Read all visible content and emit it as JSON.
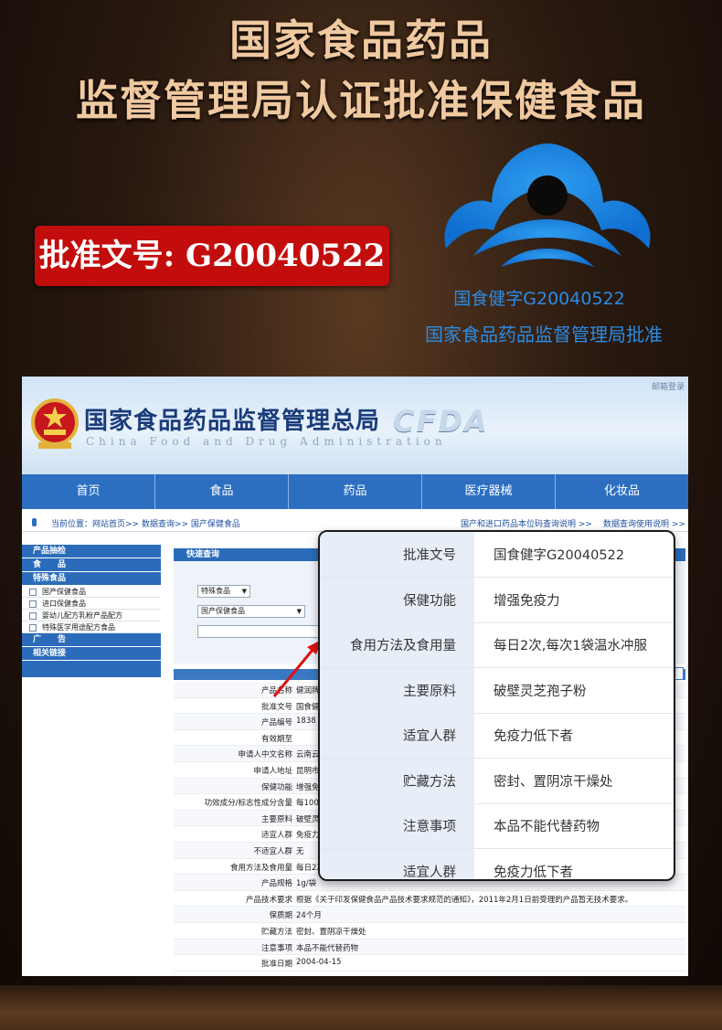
{
  "headline": {
    "line1": "国家食品药品",
    "line2": "监督管理局认证批准保健食品"
  },
  "badge": {
    "text": "批准文号: G20040522"
  },
  "logo": {
    "caption1": "国食健字G20040522",
    "caption2": "国家食品药品监督管理局批准"
  },
  "site": {
    "title": "国家食品药品监督管理总局",
    "subtitle": "China Food and Drug Administration",
    "brand": "CFDA",
    "login": "邮箱登录",
    "nav": [
      "首页",
      "食品",
      "药品",
      "医疗器械",
      "化妆品"
    ],
    "breadcrumb": "当前位置：网站首页>> 数据查询>> 国产保健食品",
    "breadcrumb_right1": "国产和进口药品本位码查询说明 >>",
    "breadcrumb_right2": "数据查询使用说明 >>"
  },
  "sidebar": {
    "h1": "产品抽检",
    "h2": "食　　品",
    "h3": "特殊食品",
    "subs": [
      "国产保健食品",
      "进口保健食品",
      "婴幼儿配方乳粉产品配方",
      "特殊医学用途配方食品"
    ],
    "h4": "广　　告",
    "h5": "相关链接"
  },
  "quick_search": {
    "title": "快速查询",
    "select1": "特殊食品",
    "select2": "国产保健食品"
  },
  "detail": {
    "tab": "返",
    "rows": [
      {
        "label": "产品名称",
        "value": "健润牌破壁灵芝"
      },
      {
        "label": "批准文号",
        "value": "国食健字G20"
      },
      {
        "label": "产品编号",
        "value": "1838"
      },
      {
        "label": "有效期至",
        "value": ""
      },
      {
        "label": "申请人中文名称",
        "value": "云南云绿生物"
      },
      {
        "label": "申请人地址",
        "value": "昆明市高新区"
      },
      {
        "label": "保健功能",
        "value": "增强免疫力"
      },
      {
        "label": "功效成分/标志性成分含量",
        "value": "每100g含：多"
      },
      {
        "label": "主要原料",
        "value": "破壁灵芝孢子"
      },
      {
        "label": "适宜人群",
        "value": "免疫力低下者"
      },
      {
        "label": "不适宜人群",
        "value": "无"
      },
      {
        "label": "食用方法及食用量",
        "value": "每日2次，每"
      },
      {
        "label": "产品规格",
        "value": "1g/袋"
      },
      {
        "label": "产品技术要求",
        "value": "根据《关于印发保健食品产品技术要求规范的通知》，2011年2月1日前受理的产品暂无技术要求。"
      },
      {
        "label": "保质期",
        "value": "24个月"
      },
      {
        "label": "贮藏方法",
        "value": "密封、置阴凉干燥处"
      },
      {
        "label": "注意事项",
        "value": "本品不能代替药物"
      },
      {
        "label": "批准日期",
        "value": "2004-04-15"
      }
    ]
  },
  "popup": {
    "rows": [
      {
        "label": "批准文号",
        "value": "国食健字G20040522"
      },
      {
        "label": "保健功能",
        "value": "增强免疫力"
      },
      {
        "label": "食用方法及食用量",
        "value": "每日2次,每次1袋温水冲服"
      },
      {
        "label": "主要原料",
        "value": "破壁灵芝孢子粉"
      },
      {
        "label": "适宜人群",
        "value": "免疫力低下者"
      },
      {
        "label": "贮藏方法",
        "value": "密封、置阴凉干燥处"
      },
      {
        "label": "注意事项",
        "value": "本品不能代替药物"
      },
      {
        "label": "适宜人群",
        "value": "免疫力低下者"
      }
    ]
  },
  "colors": {
    "accent_blue": "#2c6fc1",
    "badge_red": "#c30d0d",
    "headline_gold": "#f0c9a0"
  }
}
